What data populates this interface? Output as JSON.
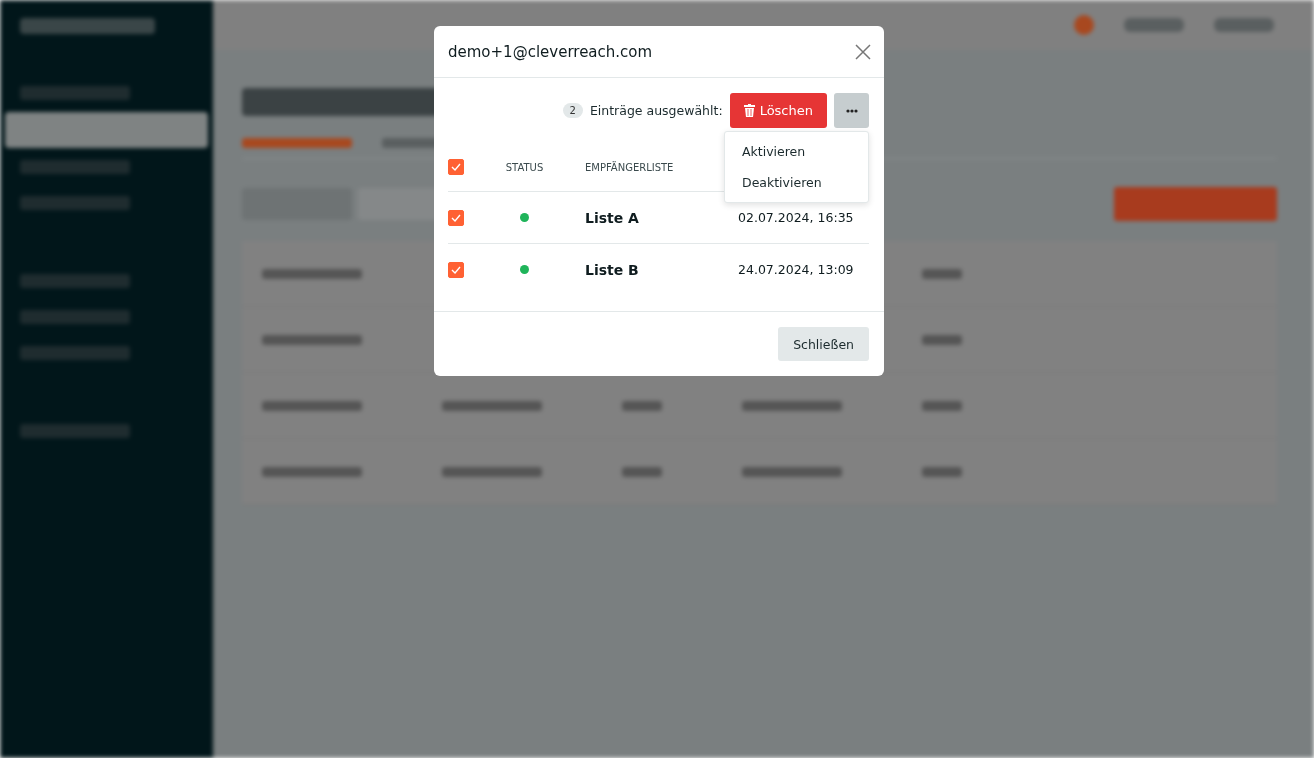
{
  "dialog": {
    "title": "demo+1@cleverreach.com",
    "selection_count": "2",
    "selection_label": "Einträge ausgewählt:",
    "delete_button": "Löschen",
    "more_menu": {
      "expanded": true,
      "items": [
        {
          "label": "Aktivieren"
        },
        {
          "label": "Deaktivieren"
        }
      ]
    },
    "table": {
      "all_checked": true,
      "columns": [
        "STATUS",
        "EMPFÄNGERLISTE"
      ],
      "rows": [
        {
          "checked": true,
          "color": "#1fb45a",
          "name": "Liste A",
          "date": "02.07.2024, 16:35"
        },
        {
          "checked": true,
          "color": "#1fb45a",
          "name": "Liste B",
          "date": "24.07.2024, 13:09"
        }
      ]
    },
    "close_button": "Schließen"
  }
}
